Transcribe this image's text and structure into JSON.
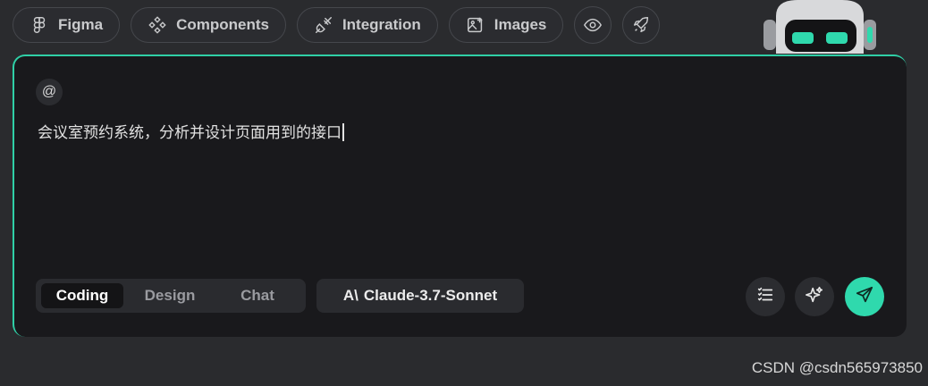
{
  "toolbar": {
    "chips": [
      {
        "label": "Figma",
        "icon": "figma-icon"
      },
      {
        "label": "Components",
        "icon": "components-icon"
      },
      {
        "label": "Integration",
        "icon": "plug-icon"
      },
      {
        "label": "Images",
        "icon": "image-icon"
      }
    ],
    "preview_icon": "eye-icon",
    "deploy_icon": "rocket-icon"
  },
  "editor": {
    "mention_symbol": "@",
    "prompt_text": "会议室预约系统，分析并设计页面用到的接口"
  },
  "modes": {
    "items": [
      "Coding",
      "Design",
      "Chat"
    ],
    "selected": "Coding"
  },
  "model": {
    "logo_text": "A\\",
    "name": "Claude-3.7-Sonnet"
  },
  "actions": {
    "list_icon": "list-icon",
    "enhance_icon": "sparkle-icon",
    "send_icon": "send-icon"
  },
  "colors": {
    "accent": "#2fd9ad",
    "panel": "#19191c",
    "background": "#2a2b2e"
  },
  "watermark": "CSDN @csdn565973850"
}
